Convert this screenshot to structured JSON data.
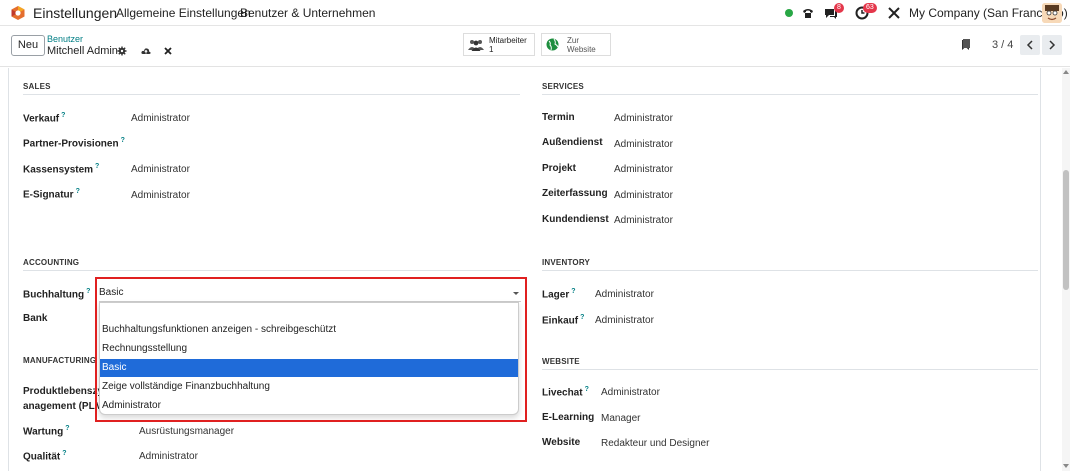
{
  "navbar": {
    "app_name": "Einstellungen",
    "menu": [
      "Allgemeine Einstellungen",
      "Benutzer & Unternehmen"
    ],
    "messages_count": "8",
    "activities_count": "63",
    "company": "My Company (San Francisco)",
    "icons": [
      "odoo-logo-icon",
      "phone-icon",
      "chat-icon",
      "clock-icon",
      "tools-icon",
      "avatar"
    ]
  },
  "control_panel": {
    "new_button": "Neu",
    "breadcrumb_parent": "Benutzer",
    "breadcrumb_current": "Mitchell Admin",
    "smart_buttons": [
      {
        "line1": "Mitarbeiter",
        "line2": "1",
        "icon": "users-icon"
      },
      {
        "line1": "Zur",
        "line2": "Website",
        "icon": "globe-icon"
      }
    ],
    "pager": "3 / 4"
  },
  "form": {
    "sales": {
      "title": "SALES",
      "fields": [
        {
          "label": "Verkauf",
          "help": "?",
          "value": "Administrator"
        },
        {
          "label": "Partner-Provisionen",
          "help": "?",
          "value": ""
        },
        {
          "label": "Kassensystem",
          "help": "?",
          "value": "Administrator"
        },
        {
          "label": "E-Signatur",
          "help": "?",
          "value": "Administrator"
        }
      ]
    },
    "services": {
      "title": "SERVICES",
      "fields": [
        {
          "label": "Termin",
          "value": "Administrator"
        },
        {
          "label": "Außendienst",
          "value": "Administrator"
        },
        {
          "label": "Projekt",
          "value": "Administrator"
        },
        {
          "label": "Zeiterfassung",
          "value": "Administrator"
        },
        {
          "label": "Kundendienst",
          "value": "Administrator"
        }
      ]
    },
    "accounting": {
      "title": "ACCOUNTING",
      "fields": [
        {
          "label": "Buchhaltung",
          "help": "?",
          "value": "Basic"
        },
        {
          "label": "Bank",
          "value": ""
        }
      ]
    },
    "inventory": {
      "title": "INVENTORY",
      "fields": [
        {
          "label": "Lager",
          "help": "?",
          "value": "Administrator"
        },
        {
          "label": "Einkauf",
          "help": "?",
          "value": "Administrator"
        }
      ]
    },
    "manufacturing": {
      "title": "MANUFACTURING",
      "fields": [
        {
          "label_line1": "Produktlebenszy",
          "label_line2": "anagement (PLM",
          "value": ""
        },
        {
          "label": "Wartung",
          "help": "?",
          "value": "Ausrüstungsmanager"
        },
        {
          "label": "Qualität",
          "help": "?",
          "value": "Administrator"
        }
      ]
    },
    "website": {
      "title": "WEBSITE",
      "fields": [
        {
          "label": "Livechat",
          "help": "?",
          "value": "Administrator"
        },
        {
          "label": "E-Learning",
          "value": "Manager"
        },
        {
          "label": "Website",
          "value": "Redakteur und Designer"
        }
      ]
    }
  },
  "dropdown": {
    "options": [
      "",
      "Buchhaltungsfunktionen anzeigen - schreibgeschützt",
      "Rechnungsstellung",
      "Basic",
      "Zeige vollständige Finanzbuchhaltung",
      "Administrator"
    ],
    "selected_index": 3
  },
  "colors": {
    "accent": "#017e84",
    "selection": "#1f6bd9",
    "highlight_border": "#e02020",
    "badge": "#e4374b"
  }
}
